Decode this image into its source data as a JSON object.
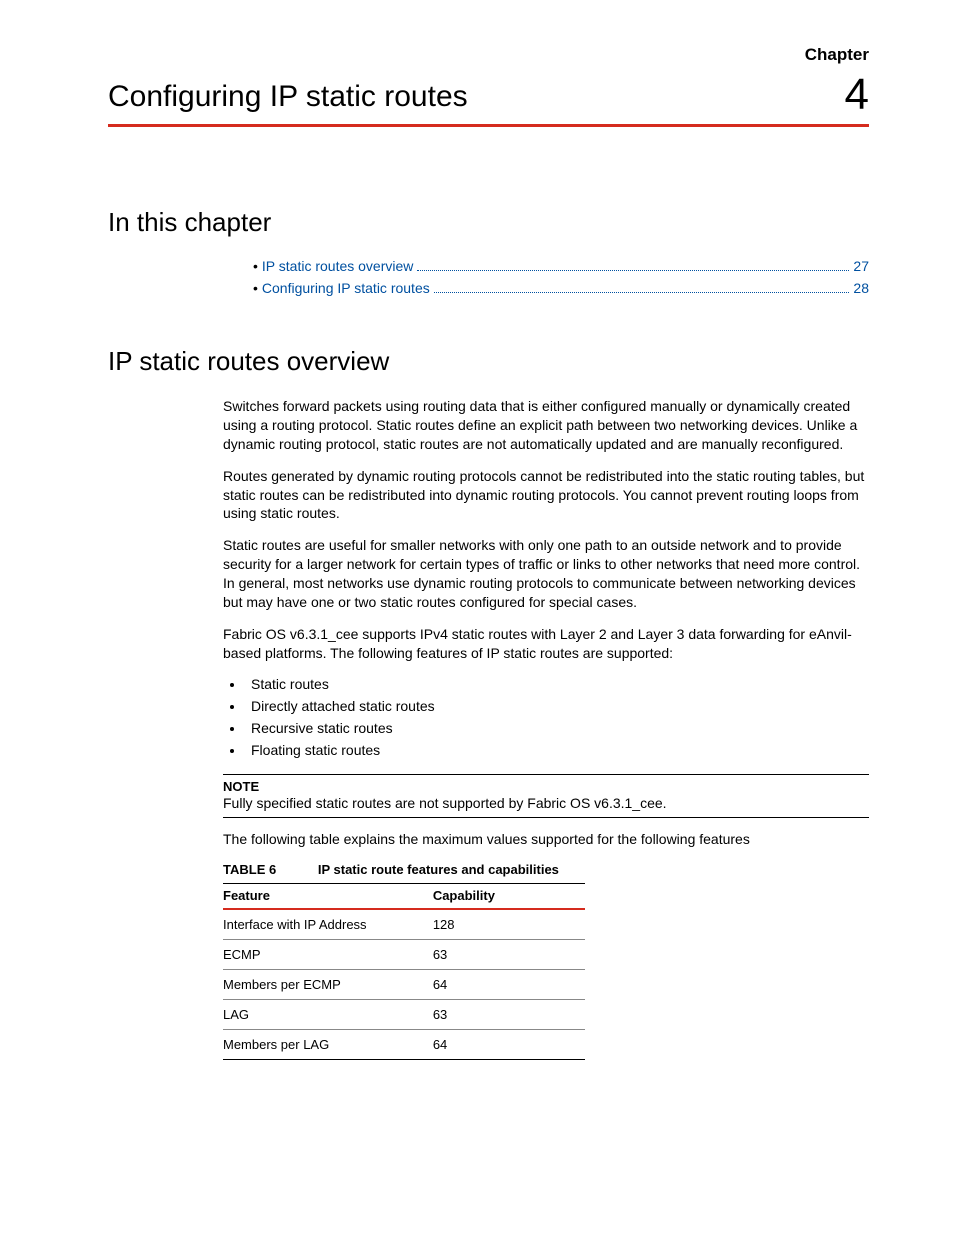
{
  "chapter": {
    "label": "Chapter",
    "number": "4",
    "title": "Configuring IP static routes"
  },
  "sections": {
    "inThisChapter": "In this chapter",
    "overview": "IP static routes overview"
  },
  "toc": [
    {
      "label": "IP static routes overview",
      "page": "27"
    },
    {
      "label": "Configuring IP static routes",
      "page": "28"
    }
  ],
  "paragraphs": {
    "p1": "Switches forward packets using routing data that is either configured manually or dynamically created using a routing protocol. Static routes define an explicit path between two networking devices. Unlike a dynamic routing protocol, static routes are not automatically updated and are manually reconfigured.",
    "p2": "Routes generated by dynamic routing protocols cannot be redistributed into the static routing tables, but static routes can be redistributed into dynamic routing protocols. You cannot prevent routing loops from using static routes.",
    "p3": "Static routes are useful for smaller networks with only one path to an outside network and to provide security for a larger network for certain types of traffic or links to other networks that need more control. In general, most networks use dynamic routing protocols to communicate between networking devices but may have one or two static routes configured for special cases.",
    "p4": "Fabric OS v6.3.1_cee supports IPv4 static routes with Layer 2 and Layer 3 data forwarding for eAnvil-based platforms. The following features of IP static routes are supported:",
    "p5": "The following table explains the maximum values supported for the following features"
  },
  "features": [
    "Static routes",
    "Directly attached static routes",
    "Recursive static routes",
    "Floating static routes"
  ],
  "note": {
    "label": "NOTE",
    "text": "Fully specified static routes are not supported by Fabric OS v6.3.1_cee."
  },
  "table": {
    "label": "TABLE 6",
    "title": "IP static route features and capabilities",
    "headers": {
      "feature": "Feature",
      "capability": "Capability"
    },
    "rows": [
      {
        "feature": "Interface with IP Address",
        "capability": "128"
      },
      {
        "feature": "ECMP",
        "capability": "63"
      },
      {
        "feature": "Members per ECMP",
        "capability": "64"
      },
      {
        "feature": "LAG",
        "capability": "63"
      },
      {
        "feature": "Members per LAG",
        "capability": "64"
      }
    ]
  }
}
